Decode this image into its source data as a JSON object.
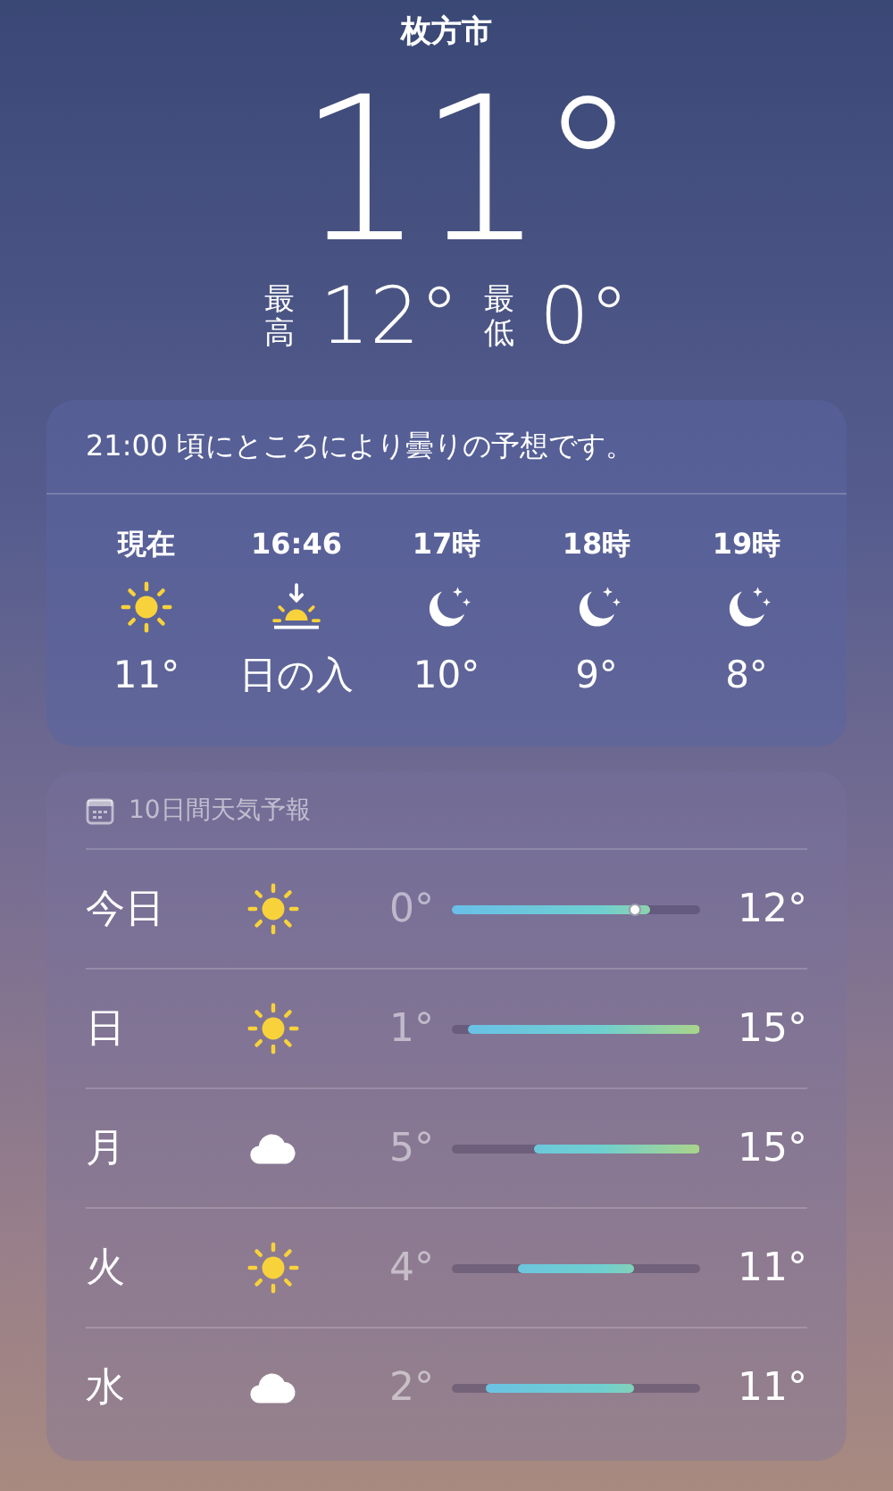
{
  "location": {
    "city": "枚方市",
    "temperature": "11°",
    "high_label": "最高",
    "high": "12°",
    "low_label": "最低",
    "low": "0°"
  },
  "hourly": {
    "summary": "21:00 頃にところにより曇りの予想です。",
    "items": [
      {
        "time": "現在",
        "kind": "sun",
        "temp": "11°"
      },
      {
        "time": "16:46",
        "kind": "sunset",
        "temp": "日の入"
      },
      {
        "time": "17時",
        "kind": "moon",
        "temp": "10°"
      },
      {
        "time": "18時",
        "kind": "moon",
        "temp": "9°"
      },
      {
        "time": "19時",
        "kind": "moon",
        "temp": "8°"
      }
    ]
  },
  "daily": {
    "title": "10日間天気予報",
    "days": [
      {
        "day": "今日",
        "kind": "sun",
        "low": "0°",
        "high": "12°",
        "current_marker": true
      },
      {
        "day": "日",
        "kind": "sun",
        "low": "1°",
        "high": "15°",
        "current_marker": false
      },
      {
        "day": "月",
        "kind": "cloud",
        "low": "5°",
        "high": "15°",
        "current_marker": false
      },
      {
        "day": "火",
        "kind": "sun",
        "low": "4°",
        "high": "11°",
        "current_marker": false
      },
      {
        "day": "水",
        "kind": "cloud",
        "low": "2°",
        "high": "11°",
        "current_marker": false
      }
    ]
  }
}
